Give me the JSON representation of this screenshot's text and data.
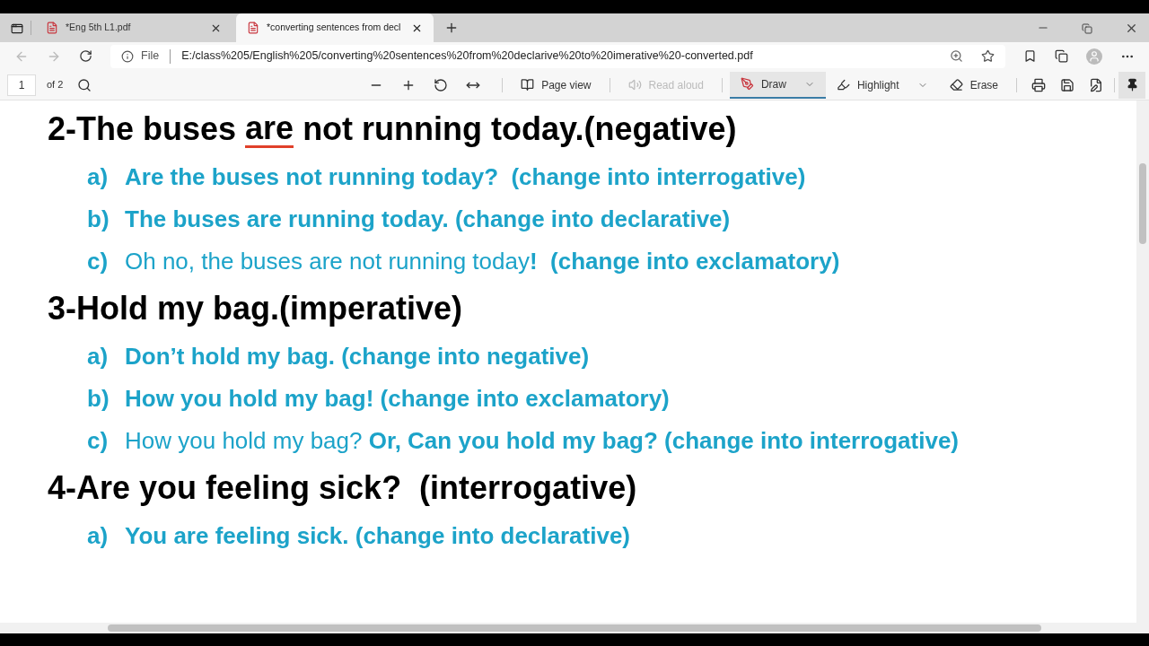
{
  "tabs": [
    {
      "title": "*Eng 5th L1.pdf",
      "selected": false
    },
    {
      "title": "*converting sentences from decl",
      "selected": true
    }
  ],
  "address_bar": {
    "scheme": "File",
    "url": "E:/class%205/English%205/converting%20sentences%20from%20declarive%20to%20imerative%20-converted.pdf"
  },
  "pdf_toolbar": {
    "page": "1",
    "page_count": "of 2",
    "tools": [
      {
        "kind": "page_view",
        "label": "Page view",
        "disabled": false,
        "selected": false
      },
      {
        "kind": "read_aloud",
        "label": "Read aloud",
        "disabled": true,
        "selected": false
      },
      {
        "kind": "draw",
        "label": "Draw",
        "disabled": false,
        "selected": true
      },
      {
        "kind": "highlight",
        "label": "Highlight",
        "disabled": false,
        "selected": false
      },
      {
        "kind": "erase",
        "label": "Erase",
        "disabled": false,
        "selected": false
      }
    ],
    "pin_selected": true
  },
  "document": {
    "sections": [
      {
        "heading": [
          {
            "text": "2-The buses ",
            "underlined": false
          },
          {
            "text": "are",
            "underlined": true
          },
          {
            "text": " not running today.(negative)",
            "underlined": false
          }
        ],
        "items": [
          {
            "marker": "a)",
            "text": "**Are the buses not running today?  (change into interrogative)**"
          },
          {
            "marker": "b)",
            "text": "**The buses are running today. (change into declarative)**"
          },
          {
            "marker": "c)",
            "text": "Oh no, the buses are not running today**!**  **(change into exclamatory)**"
          }
        ]
      },
      {
        "heading": [
          {
            "text": "3-Hold my bag.(imperative)",
            "underlined": false
          }
        ],
        "items": [
          {
            "marker": "a)",
            "text": "**Don’t hold my bag. (change into negative)**"
          },
          {
            "marker": "b)",
            "text": "**How you hold my bag! (change into exclamatory)**"
          },
          {
            "marker": "c)",
            "text": "How you hold my bag? **Or, Can you hold my bag? (change into interrogative)**"
          }
        ]
      },
      {
        "heading": [
          {
            "text": "4-Are you feeling sick?  (interrogative)",
            "underlined": false
          }
        ],
        "items": [
          {
            "marker": "a)",
            "text": "**You are feeling sick. (change into declarative)**"
          }
        ]
      }
    ]
  }
}
